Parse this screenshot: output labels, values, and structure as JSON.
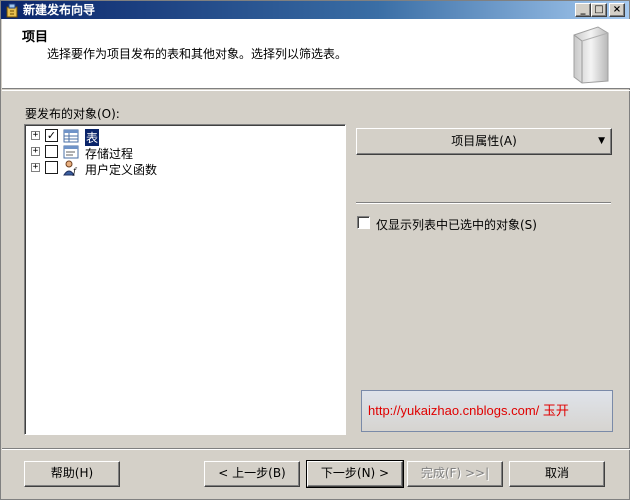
{
  "window": {
    "title": "新建发布向导",
    "controls": {
      "minimize": "_",
      "maximize": "□",
      "close": "×"
    }
  },
  "header": {
    "title": "项目",
    "description": "选择要作为项目发布的表和其他对象。选择列以筛选表。"
  },
  "objects": {
    "label": "要发布的对象(O):",
    "items": [
      {
        "label": "表",
        "checked": true,
        "selected": true,
        "expander": "+",
        "icon": "table-icon"
      },
      {
        "label": "存储过程",
        "checked": false,
        "selected": false,
        "expander": "+",
        "icon": "stored-procedure-icon"
      },
      {
        "label": "用户定义函数",
        "checked": false,
        "selected": false,
        "expander": "+",
        "icon": "user-function-icon"
      }
    ]
  },
  "properties_button": {
    "label": "项目属性(A)",
    "arrow": "▼"
  },
  "show_selected": {
    "label": "仅显示列表中已选中的对象(S)",
    "checked": false
  },
  "watermark": {
    "text": "http://yukaizhao.cnblogs.com/ 玉开"
  },
  "buttons": {
    "help": "帮助(H)",
    "back": "< 上一步(B)",
    "next": "下一步(N) >",
    "finish": "完成(F) >>|",
    "cancel": "取消"
  },
  "colors": {
    "titlebar_start": "#0a246a",
    "titlebar_end": "#a6caf0",
    "dialog_bg": "#d4d0c8",
    "selection": "#0a246a",
    "watermark_text": "#e00000"
  }
}
